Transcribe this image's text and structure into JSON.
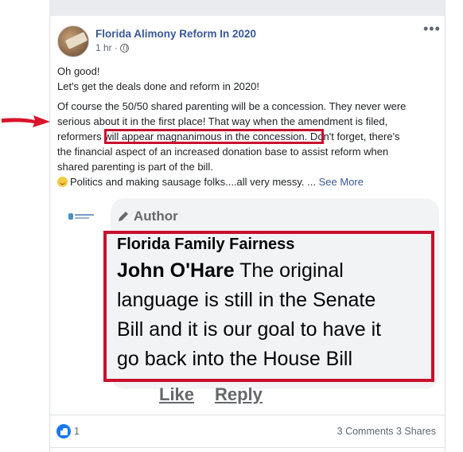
{
  "post": {
    "page_name": "Florida Alimony Reform In 2020",
    "time": "1 hr",
    "separator": "·",
    "more_label": "•••",
    "lines": [
      "Oh good!",
      "Let's get the deals done and reform in 2020!",
      "Of course the 50/50 shared parenting will be a concession. They never were",
      "serious about it in the first place! That way when the amendment is filed,",
      "reformers will appear magnanimous in the concession. Don't forget, there's",
      "the financial aspect of an increased donation base to assist reform when",
      "shared parenting is part of the bill.",
      "Politics and making sausage folks....all very messy. ..."
    ],
    "see_more": "See More"
  },
  "comment": {
    "author_tag": "Author",
    "org_name": "Florida Family Fairness",
    "commenter": "John O'Hare",
    "lines": [
      " The original",
      "language is still in the Senate",
      "Bill and it is our goal to have it",
      "go back into the House Bill"
    ],
    "like_label": "Like",
    "reply_label": "Reply"
  },
  "footer": {
    "reaction_count": "1",
    "stats": "3 Comments  3 Shares"
  },
  "colors": {
    "link_blue": "#385898",
    "highlight_red": "#c8102e",
    "like_blue": "#1877f2"
  },
  "icons": [
    "globe-icon",
    "more-icon",
    "smile-emoji-icon",
    "pencil-icon",
    "like-icon",
    "red-arrow-icon"
  ]
}
